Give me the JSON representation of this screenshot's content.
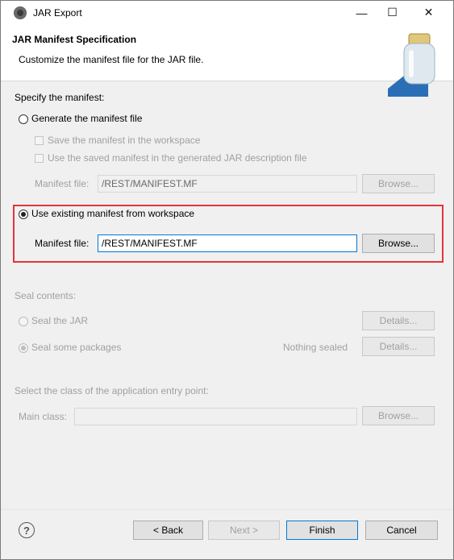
{
  "window": {
    "title": "JAR Export",
    "minimize_glyph": "—",
    "maximize_glyph": "☐",
    "close_glyph": "✕"
  },
  "header": {
    "title": "JAR Manifest Specification",
    "subtitle": "Customize the manifest file for the JAR file.",
    "image_icon": "jar-icon"
  },
  "manifest": {
    "section_label": "Specify the manifest:",
    "generate_label": "Generate the manifest file",
    "save_in_workspace_label": "Save the manifest in the workspace",
    "use_saved_label": "Use the saved manifest in the generated JAR description file",
    "gen_manifest_file_label": "Manifest file:",
    "gen_manifest_file_value": "/REST/MANIFEST.MF",
    "gen_browse_label": "Browse...",
    "use_existing_label": "Use existing manifest from workspace",
    "existing_manifest_file_label": "Manifest file:",
    "existing_manifest_file_value": "/REST/MANIFEST.MF",
    "existing_browse_label": "Browse..."
  },
  "seal": {
    "section_label": "Seal contents:",
    "seal_jar_label": "Seal the JAR",
    "seal_jar_details": "Details...",
    "seal_some_label": "Seal some packages",
    "nothing_sealed": "Nothing sealed",
    "seal_some_details": "Details..."
  },
  "entry": {
    "section_label": "Select the class of the application entry point:",
    "main_class_label": "Main class:",
    "main_class_value": "",
    "browse_label": "Browse..."
  },
  "footer": {
    "help_glyph": "?",
    "back_label": "< Back",
    "next_label": "Next >",
    "finish_label": "Finish",
    "cancel_label": "Cancel"
  },
  "colors": {
    "highlight_border": "#e0353b",
    "focus_blue": "#0078d7"
  }
}
